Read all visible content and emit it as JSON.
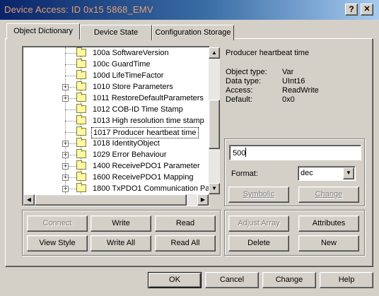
{
  "window": {
    "title": "Device Access: ID 0x15 5868_EMV",
    "help_label": "?",
    "close_label": "✕"
  },
  "tabs": [
    {
      "label": "Object Dictionary",
      "active": true
    },
    {
      "label": "Device State",
      "active": false
    },
    {
      "label": "Configuration Storage",
      "active": false
    }
  ],
  "tree": {
    "items": [
      {
        "label": "100a SoftwareVersion",
        "expandable": false,
        "selected": false
      },
      {
        "label": "100c GuardTime",
        "expandable": false,
        "selected": false
      },
      {
        "label": "100d LifeTimeFactor",
        "expandable": false,
        "selected": false
      },
      {
        "label": "1010 Store Parameters",
        "expandable": true,
        "selected": false
      },
      {
        "label": "1011 RestoreDefaultParameters",
        "expandable": true,
        "selected": false
      },
      {
        "label": "1012 COB-ID Time Stamp",
        "expandable": false,
        "selected": false
      },
      {
        "label": "1013 High resolution time stamp",
        "expandable": false,
        "selected": false
      },
      {
        "label": "1017 Producer heartbeat time",
        "expandable": false,
        "selected": true
      },
      {
        "label": "1018 IdentityObject",
        "expandable": true,
        "selected": false
      },
      {
        "label": "1029 Error Behaviour",
        "expandable": true,
        "selected": false
      },
      {
        "label": "1400 ReceivePDO1 Parameter",
        "expandable": true,
        "selected": false
      },
      {
        "label": "1600 ReceivePDO1 Mapping",
        "expandable": true,
        "selected": false
      },
      {
        "label": "1800 TxPDO1 Communication Para",
        "expandable": true,
        "selected": false
      }
    ],
    "expand_glyph": "+",
    "vscroll_position": 0.55,
    "hscroll_position": 0.0
  },
  "details": {
    "title": "Producer heartbeat time",
    "rows": [
      {
        "key": "Object type:",
        "value": "Var"
      },
      {
        "key": "Data type:",
        "value": "UInt16"
      },
      {
        "key": "Access:",
        "value": "ReadWrite"
      },
      {
        "key": "Default:",
        "value": "0x0"
      }
    ]
  },
  "value_editor": {
    "value": "500",
    "format_label": "Format:",
    "format_value": "dec",
    "symbolic_label": "Symbolic",
    "change_label": "Change"
  },
  "left_buttons": {
    "connect": "Connect",
    "write": "Write",
    "read": "Read",
    "view_style": "View Style",
    "write_all": "Write All",
    "read_all": "Read All"
  },
  "right_buttons": {
    "adjust_array": "Adjust Array",
    "attributes": "Attributes",
    "delete": "Delete",
    "new": "New"
  },
  "footer": {
    "ok": "OK",
    "cancel": "Cancel",
    "change": "Change",
    "help": "Help"
  },
  "colors": {
    "title_start": "#0a246a",
    "title_end": "#a6caf0",
    "title_text": "#e8a070",
    "face": "#d4d0c8"
  }
}
